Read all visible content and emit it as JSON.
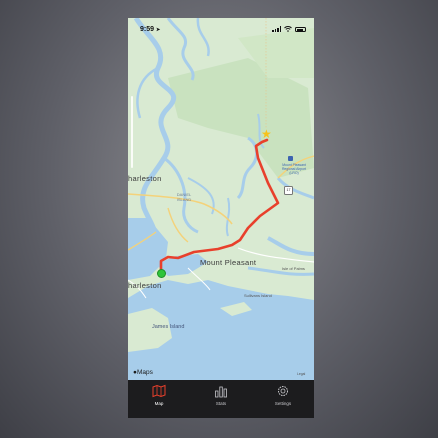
{
  "status": {
    "time": "9:59"
  },
  "map": {
    "labels": {
      "charleston_north": "harleston",
      "charleston_south": "harleston",
      "mount_pleasant": "Mount Pleasant",
      "isle_of_palms": "Isle of Palms",
      "sullivans_island": "Sullivans Island",
      "james_island": "James Island",
      "daniel_island": "DANIEL ISLAND",
      "airport": "Mount Pleasant Regional Airport (LRO)",
      "route_number": "17"
    },
    "attribution": "Maps",
    "legal": "Legal",
    "route_color": "#e8402c",
    "start_color": "#2fc43a",
    "end_color": "#f7c21b"
  },
  "tabs": [
    {
      "label": "Map",
      "icon": "map-icon",
      "active": true
    },
    {
      "label": "Stats",
      "icon": "stats-icon",
      "active": false
    },
    {
      "label": "Settings",
      "icon": "gear-icon",
      "active": false
    }
  ]
}
